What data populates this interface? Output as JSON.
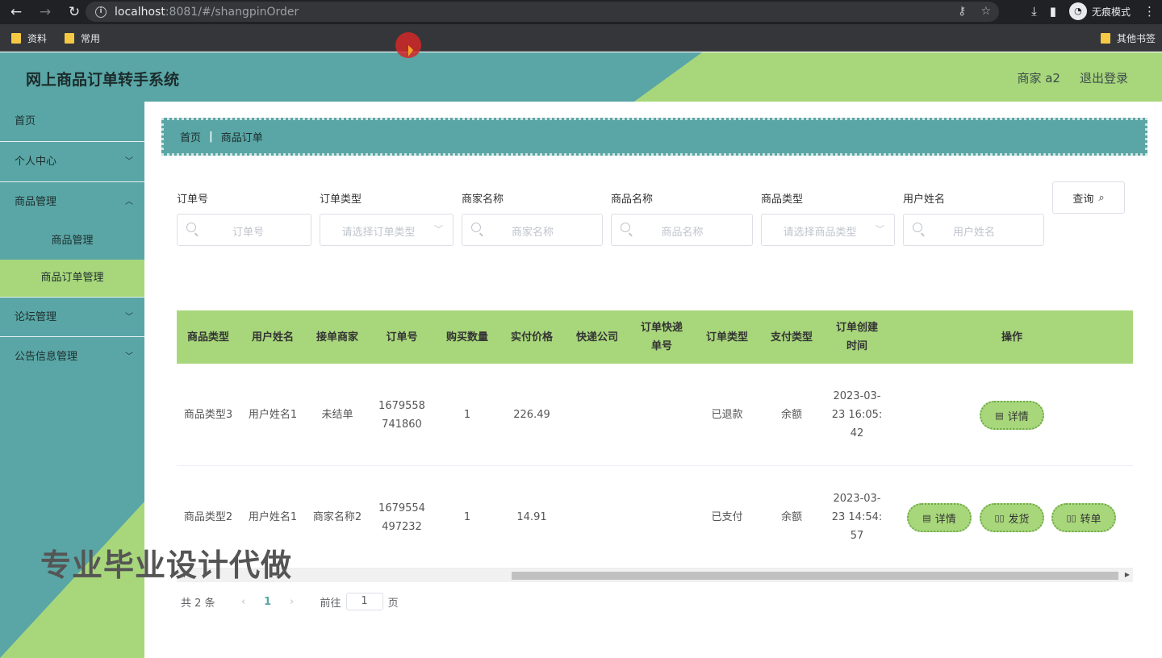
{
  "browser": {
    "url_host": "localhost",
    "url_rest": ":8081/#/shangpinOrder",
    "incognito_label": "无痕模式",
    "bookmarks": [
      "资料",
      "常用"
    ],
    "other_bookmarks": "其他书签"
  },
  "header": {
    "title": "网上商品订单转手系统",
    "user": "商家 a2",
    "logout": "退出登录"
  },
  "sidebar": {
    "items": [
      {
        "label": "首页"
      },
      {
        "label": "个人中心"
      },
      {
        "label": "商品管理"
      },
      {
        "label": "商品管理"
      },
      {
        "label": "商品订单管理"
      },
      {
        "label": "论坛管理"
      },
      {
        "label": "公告信息管理"
      }
    ],
    "watermark": "专业毕业设计代做"
  },
  "breadcrumb": {
    "home": "首页",
    "current": "商品订单"
  },
  "filters": {
    "order_no": {
      "label": "订单号",
      "placeholder": "订单号"
    },
    "order_type": {
      "label": "订单类型",
      "placeholder": "请选择订单类型"
    },
    "merchant": {
      "label": "商家名称",
      "placeholder": "商家名称"
    },
    "product": {
      "label": "商品名称",
      "placeholder": "商品名称"
    },
    "product_type": {
      "label": "商品类型",
      "placeholder": "请选择商品类型"
    },
    "user": {
      "label": "用户姓名",
      "placeholder": "用户姓名"
    },
    "search_label": "查询"
  },
  "table": {
    "headers": [
      "商品类型",
      "用户姓名",
      "接单商家",
      "订单号",
      "购买数量",
      "实付价格",
      "快递公司",
      "订单快递单号",
      "订单类型",
      "支付类型",
      "订单创建时间",
      "操作"
    ],
    "rows": [
      {
        "type": "商品类型3",
        "user": "用户姓名1",
        "merchant": "未结单",
        "order_no": "1679558741860",
        "qty": "1",
        "price": "226.49",
        "courier": "",
        "tracking": "",
        "order_type": "已退款",
        "pay_type": "余额",
        "created": "2023-03-23 16:05:42",
        "actions": [
          "详情"
        ]
      },
      {
        "type": "商品类型2",
        "user": "用户姓名1",
        "merchant": "商家名称2",
        "order_no": "1679554497232",
        "qty": "1",
        "price": "14.91",
        "courier": "",
        "tracking": "",
        "order_type": "已支付",
        "pay_type": "余额",
        "created": "2023-03-23 14:54:57",
        "actions": [
          "详情",
          "发货",
          "转单"
        ]
      }
    ]
  },
  "pager": {
    "total": "共 2 条",
    "current": "1",
    "goto": "前往",
    "page_input": "1",
    "page_suffix": "页"
  }
}
